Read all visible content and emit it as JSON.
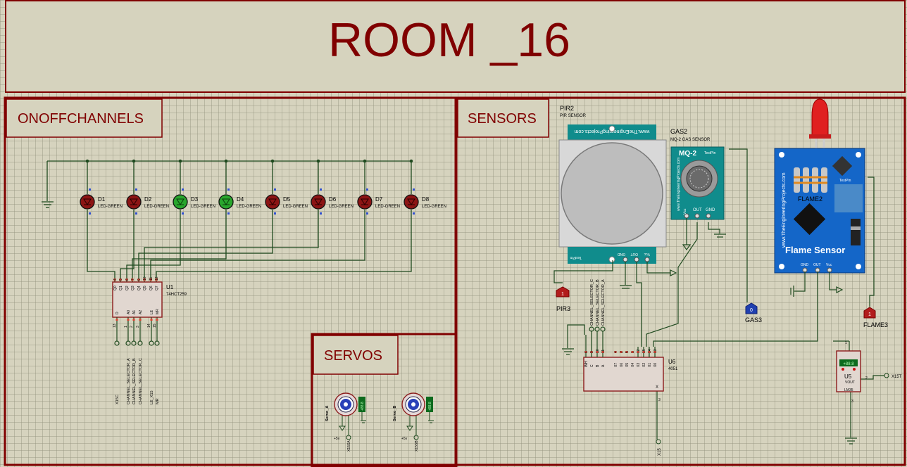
{
  "title": "ROOM _16",
  "panels": {
    "onoff": "ONOFFCHANNELS",
    "sensors": "SENSORS",
    "servos": "SERVOS"
  },
  "leds": [
    {
      "ref": "D1",
      "type": "LED-GREEN",
      "lit": false
    },
    {
      "ref": "D2",
      "type": "LED-GREEN",
      "lit": false
    },
    {
      "ref": "D3",
      "type": "LED-GREEN",
      "lit": true
    },
    {
      "ref": "D4",
      "type": "LED-GREEN",
      "lit": true
    },
    {
      "ref": "D5",
      "type": "LED-GREEN",
      "lit": false
    },
    {
      "ref": "D6",
      "type": "LED-GREEN",
      "lit": false
    },
    {
      "ref": "D7",
      "type": "LED-GREEN",
      "lit": false
    },
    {
      "ref": "D8",
      "type": "LED-GREEN",
      "lit": false
    }
  ],
  "u1": {
    "ref": "U1",
    "part": "74HCT259",
    "top_pins": [
      "Q0",
      "Q1",
      "Q2",
      "Q3",
      "Q4",
      "Q5",
      "Q6",
      "Q7"
    ],
    "top_nums": [
      "4",
      "5",
      "6",
      "7",
      "9",
      "10",
      "11",
      "12"
    ],
    "bottom_pins": [
      "D",
      "A0",
      "A1",
      "A2",
      "LE",
      "MR"
    ],
    "bottom_nums": [
      "13",
      "1",
      "2",
      "3",
      "14",
      "15"
    ],
    "nets": [
      "X15C",
      "CHANNEL_SELECTOR_A",
      "CHANNEL_SELECTOR_B",
      "CHANNEL_SELECTOR_C",
      "LE_X15",
      "MR"
    ]
  },
  "servos": [
    {
      "name": "Servo_A",
      "supply": "+5v",
      "net": "X15SA",
      "value": "+88.8"
    },
    {
      "name": "Servo_B",
      "supply": "+5v",
      "net": "X15SB",
      "value": "+88.8"
    }
  ],
  "pir": {
    "ref": "PIR2",
    "part": "PIR SENSOR",
    "site": "www.TheEngineeringProjects.com",
    "pins": [
      "GND",
      "OUT",
      "Vcc"
    ],
    "logo": "TestPin",
    "probe": "PIR3"
  },
  "gas": {
    "ref": "GAS2",
    "part": "MQ-2 GAS SENSOR",
    "model": "MQ-2",
    "site": "www.TheEngineeringProjects.com",
    "pins": [
      "Vcc",
      "OUT",
      "GND"
    ],
    "logo": "TestPin",
    "probe": "GAS3"
  },
  "flame": {
    "ref": "FLAME2",
    "title": "Flame Sensor",
    "site": "www.TheEngineeringProjects.com",
    "pins": [
      "GND",
      "OUT",
      "Vcc"
    ],
    "logo": "TestPin",
    "probe": "FLAME3"
  },
  "u6": {
    "ref": "U6",
    "part": "4051",
    "top_pins": [
      "INH",
      "C",
      "B",
      "A",
      "X7",
      "X6",
      "X5",
      "X4",
      "X3",
      "X2",
      "X1",
      "X0"
    ],
    "top_nums": [
      "6",
      "9",
      "10",
      "11",
      "4",
      "2",
      "5",
      "1",
      "12",
      "15",
      "14",
      "13"
    ],
    "out_pin": "X",
    "out_num": "3",
    "net": "X15",
    "sel_nets": [
      "CHANNEL_SELECTOR_C",
      "CHANNEL_SELECTOR_B",
      "CHANNEL_SELECTOR_A"
    ]
  },
  "u5": {
    "ref": "U5",
    "part": "LM35",
    "label": "VOUT",
    "reading": "+88.8",
    "pin1": "1",
    "pin2": "2",
    "pin3": "3",
    "net": "X15T"
  }
}
